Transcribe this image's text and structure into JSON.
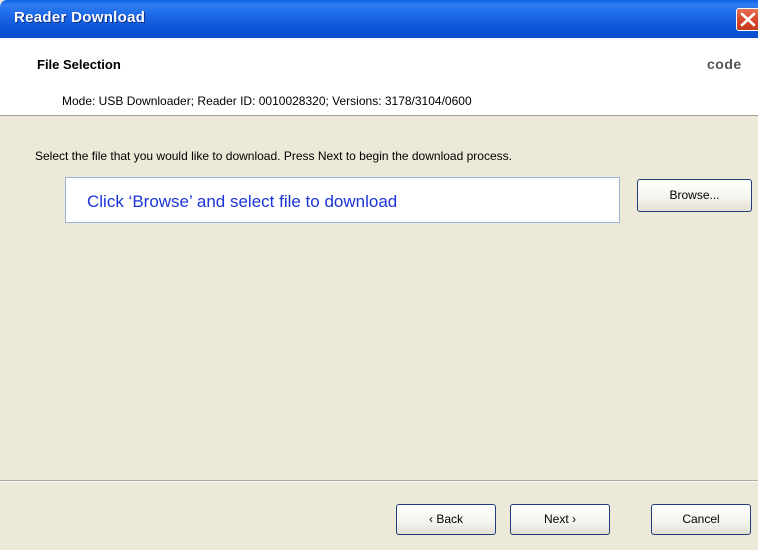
{
  "window": {
    "title": "Reader Download"
  },
  "header": {
    "title": "File Selection",
    "brand": "code",
    "mode_line": "Mode: USB Downloader; Reader ID: 0010028320; Versions: 3178/3104/0600"
  },
  "main": {
    "instructions": "Select the file that you would like to download. Press Next to begin the download process.",
    "file_placeholder": "Click ‘Browse’ and select file to download",
    "browse_label": "Browse..."
  },
  "footer": {
    "back_label": "‹ Back",
    "next_label": "Next ›",
    "cancel_label": "Cancel"
  },
  "colors": {
    "titlebar": "#0a5fe4",
    "dialog_bg": "#ece9d8",
    "placeholder_text": "#1a34d8",
    "close_button": "#d8482b"
  }
}
